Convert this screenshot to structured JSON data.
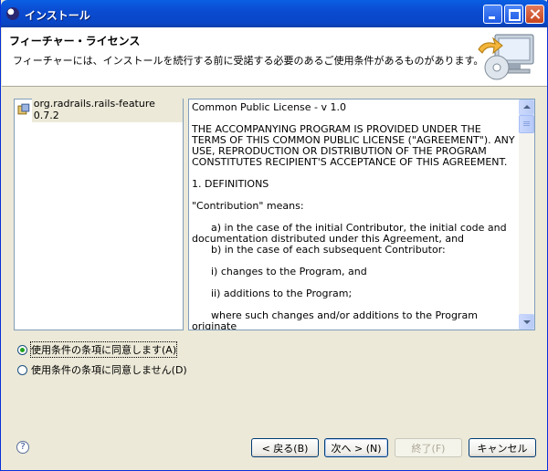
{
  "window": {
    "title": "インストール"
  },
  "header": {
    "title": "フィーチャー・ライセンス",
    "description": "フィーチャーには、インストールを続行する前に受諾する必要のあるご使用条件があるものがあります。"
  },
  "features": [
    {
      "label": "org.radrails.rails-feature 0.7.2"
    }
  ],
  "license": {
    "text": "Common Public License - v 1.0\n\nTHE ACCOMPANYING PROGRAM IS PROVIDED UNDER THE\nTERMS OF THIS COMMON PUBLIC LICENSE (\"AGREEMENT\"). ANY\nUSE, REPRODUCTION OR DISTRIBUTION OF THE PROGRAM\nCONSTITUTES RECIPIENT'S ACCEPTANCE OF THIS AGREEMENT.\n\n1. DEFINITIONS\n\n\"Contribution\" means:\n\n      a) in the case of the initial Contributor, the initial code and\ndocumentation distributed under this Agreement, and\n      b) in the case of each subsequent Contributor:\n\n      i) changes to the Program, and\n\n      ii) additions to the Program;\n\n      where such changes and/or additions to the Program originate"
  },
  "options": {
    "accept_label": "使用条件の条項に同意します(A)",
    "decline_label": "使用条件の条項に同意しません(D)",
    "selected": "accept"
  },
  "buttons": {
    "help": "?",
    "back": "< 戻る(B)",
    "next": "次へ > (N)",
    "finish": "終了(F)",
    "cancel": "キャンセル"
  },
  "icons": {
    "app": "eclipse-icon",
    "wizard": "install-wizard-icon",
    "feature": "feature-plugin-icon"
  }
}
